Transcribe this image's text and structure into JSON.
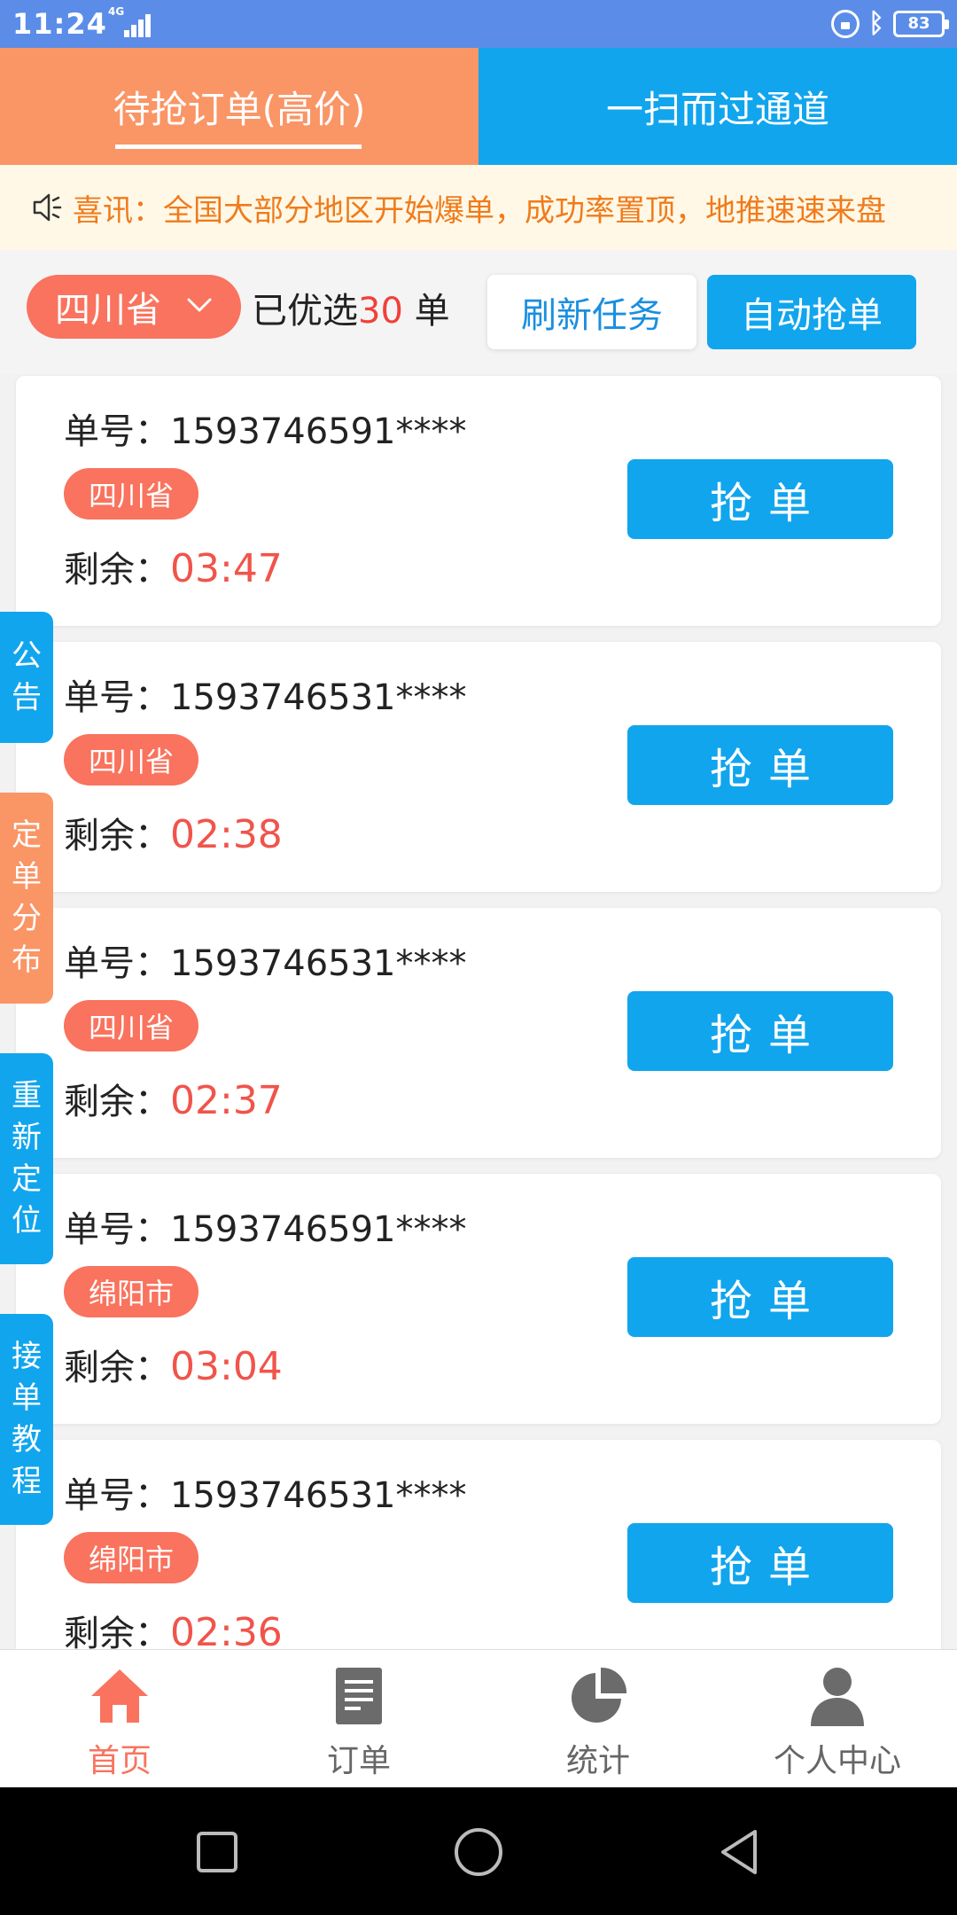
{
  "status_bar": {
    "time": "11:24",
    "network": "4G",
    "battery": "83"
  },
  "tabs": [
    {
      "label": "待抢订单(高价)",
      "active": true
    },
    {
      "label": "一扫而过通道",
      "active": false
    }
  ],
  "notice": {
    "icon": "speaker-icon",
    "text": "喜讯：全国大部分地区开始爆单，成功率置顶，地推速速来盘"
  },
  "filter": {
    "province": "四川省",
    "selected_prefix": "已优选",
    "selected_count": "30",
    "selected_suffix": " 单",
    "refresh_label": "刷新任务",
    "auto_label": "自动抢单"
  },
  "orders": [
    {
      "no_label": "单号：",
      "no": "1593746591****",
      "region": "四川省",
      "remain_label": "剩余：",
      "remain": "03:47",
      "button": "抢单"
    },
    {
      "no_label": "单号：",
      "no": "1593746531****",
      "region": "四川省",
      "remain_label": "剩余：",
      "remain": "02:38",
      "button": "抢单"
    },
    {
      "no_label": "单号：",
      "no": "1593746531****",
      "region": "四川省",
      "remain_label": "剩余：",
      "remain": "02:37",
      "button": "抢单"
    },
    {
      "no_label": "单号：",
      "no": "1593746591****",
      "region": "绵阳市",
      "remain_label": "剩余：",
      "remain": "03:04",
      "button": "抢单"
    },
    {
      "no_label": "单号：",
      "no": "1593746531****",
      "region": "绵阳市",
      "remain_label": "剩余：",
      "remain": "02:36",
      "button": "抢单"
    }
  ],
  "side_tabs": [
    {
      "chars": [
        "公",
        "告"
      ],
      "color": "blue"
    },
    {
      "chars": [
        "定",
        "单",
        "分",
        "布"
      ],
      "color": "orange"
    },
    {
      "chars": [
        "重",
        "新",
        "定",
        "位"
      ],
      "color": "blue"
    },
    {
      "chars": [
        "接",
        "单",
        "教",
        "程"
      ],
      "color": "blue"
    }
  ],
  "bottom_nav": [
    {
      "label": "首页",
      "icon": "home-icon",
      "active": true
    },
    {
      "label": "订单",
      "icon": "document-icon",
      "active": false
    },
    {
      "label": "统计",
      "icon": "pie-chart-icon",
      "active": false
    },
    {
      "label": "个人中心",
      "icon": "person-icon",
      "active": false
    }
  ],
  "colors": {
    "accent_blue": "#11a5ee",
    "accent_orange": "#fa9566",
    "tag_red": "#f9735e",
    "time_red": "#f0544b",
    "notice_text": "#f07b1c"
  }
}
